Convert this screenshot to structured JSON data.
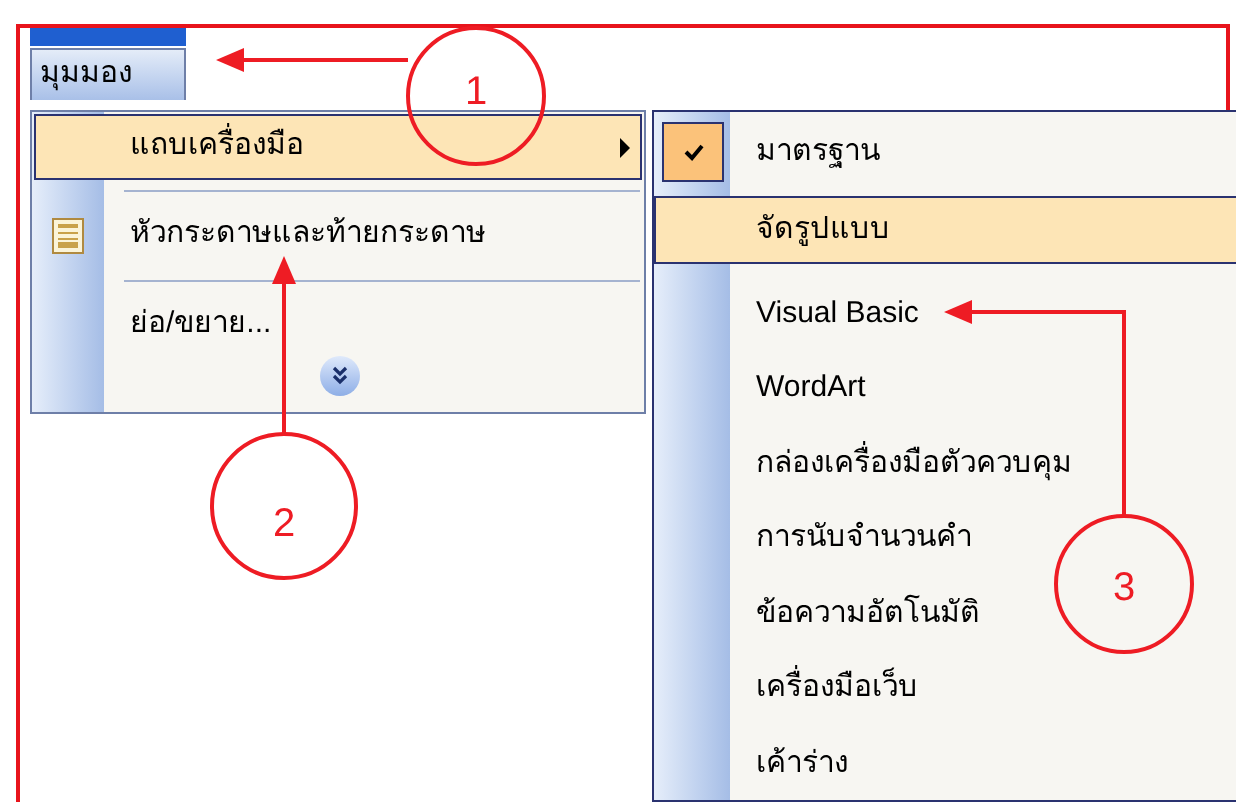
{
  "menu_bar": [
    {
      "label": "มุมมอง",
      "selected": true
    }
  ],
  "view_menu": {
    "items": [
      {
        "kind": "submenu",
        "label": "แถบเครื่องมือ",
        "selected": true
      },
      {
        "kind": "icon",
        "label": "หัวกระดาษและท้ายกระดาษ",
        "selected": false
      },
      {
        "kind": "plain",
        "label": "ย่อ/ขยาย...",
        "selected": false
      }
    ]
  },
  "toolbars_submenu": {
    "items": [
      {
        "label": "มาตรฐาน",
        "checked": true,
        "selected": false
      },
      {
        "label": "จัดรูปแบบ",
        "checked": false,
        "selected": true
      },
      {
        "label": "Visual Basic",
        "checked": false,
        "selected": false
      },
      {
        "label": "WordArt",
        "checked": false,
        "selected": false
      },
      {
        "label": "กล่องเครื่องมือตัวควบคุม",
        "checked": false,
        "selected": false
      },
      {
        "label": "การนับจำนวนคำ",
        "checked": false,
        "selected": false
      },
      {
        "label": "ข้อความอัตโนมัติ",
        "checked": false,
        "selected": false
      },
      {
        "label": "เครื่องมือเว็บ",
        "checked": false,
        "selected": false
      },
      {
        "label": "เค้าร่าง",
        "checked": false,
        "selected": false
      }
    ]
  },
  "annotations": [
    {
      "label": "1"
    },
    {
      "label": "2"
    },
    {
      "label": "3"
    }
  ]
}
